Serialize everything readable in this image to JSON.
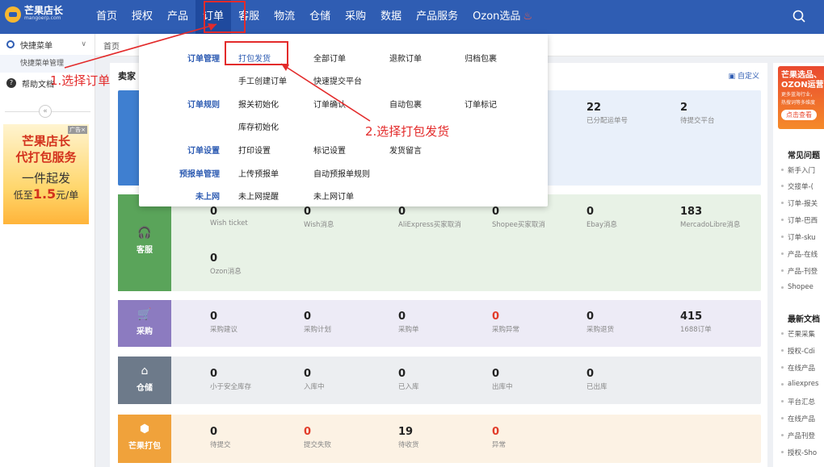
{
  "brand": {
    "name": "芒果店长",
    "domain": "mangoerp.com"
  },
  "nav": [
    "首页",
    "授权",
    "产品",
    "订单",
    "客服",
    "物流",
    "仓储",
    "采购",
    "数据",
    "产品服务",
    "Ozon选品"
  ],
  "sidebar": {
    "quick_menu": "快捷菜单",
    "quick_menu_manage": "快捷菜单管理",
    "help_docs": "帮助文档",
    "collapse": "«",
    "ad": {
      "tag": "广告×",
      "line1": "芒果店长",
      "line2": "代打包服务",
      "line3": "一件起发",
      "line4_pre": "低至",
      "line4_num": "1.5",
      "line4_post": "元/单"
    }
  },
  "breadcrumb": "首页",
  "main": {
    "title": "卖家",
    "customize": "自定义"
  },
  "dropdown": [
    {
      "label": "订单管理",
      "items": [
        "打包发货",
        "全部订单",
        "退款订单",
        "归档包裹",
        "手工创建订单",
        "快速提交平台"
      ]
    },
    {
      "label": "订单规则",
      "items": [
        "报关初始化",
        "订单确认",
        "自动包裹",
        "订单标记",
        "库存初始化"
      ]
    },
    {
      "label": "订单设置",
      "items": [
        "打印设置",
        "标记设置",
        "发货留言"
      ]
    },
    {
      "label": "预报单管理",
      "items": [
        "上传预报单",
        "自动预报单规则"
      ]
    },
    {
      "label": "未上网",
      "items": [
        "未上网提醒",
        "未上网订单"
      ]
    }
  ],
  "order_stats": [
    {
      "value": "22",
      "label": "已分配运单号"
    },
    {
      "value": "2",
      "label": "待提交平台"
    }
  ],
  "service": {
    "label": "客服",
    "stats": [
      {
        "value": "0",
        "label": "Wish ticket"
      },
      {
        "value": "0",
        "label": "Wish消息"
      },
      {
        "value": "0",
        "label": "AliExpress买家取消"
      },
      {
        "value": "0",
        "label": "Shopee买家取消"
      },
      {
        "value": "0",
        "label": "Ebay消息"
      },
      {
        "value": "183",
        "label": "MercadoLibre消息"
      },
      {
        "value": "0",
        "label": "Ozon消息"
      }
    ]
  },
  "purchase": {
    "label": "采购",
    "stats": [
      {
        "value": "0",
        "label": "采购建议"
      },
      {
        "value": "0",
        "label": "采购计划"
      },
      {
        "value": "0",
        "label": "采购单"
      },
      {
        "value": "0",
        "label": "采购异常"
      },
      {
        "value": "0",
        "label": "采购退货"
      },
      {
        "value": "415",
        "label": "1688订单"
      }
    ]
  },
  "warehouse": {
    "label": "仓储",
    "stats": [
      {
        "value": "0",
        "label": "小于安全库存"
      },
      {
        "value": "0",
        "label": "入库中"
      },
      {
        "value": "0",
        "label": "已入库"
      },
      {
        "value": "0",
        "label": "出库中"
      },
      {
        "value": "0",
        "label": "已出库"
      }
    ]
  },
  "packing": {
    "label": "芒果打包",
    "stats": [
      {
        "value": "0",
        "label": "待提交"
      },
      {
        "value": "0",
        "label": "提交失败"
      },
      {
        "value": "19",
        "label": "待收货"
      },
      {
        "value": "0",
        "label": "异常"
      }
    ]
  },
  "right": {
    "promo": {
      "line1": "芒果选品、",
      "line2": "OZON运营",
      "line3": "更多蓝海行业，",
      "line4": "热搜词等多维度",
      "button": "点击查看"
    },
    "faq_title": "常见问题",
    "faq": [
      "新手入门",
      "交接单-(",
      "订单-报关",
      "订单-巴西",
      "订单-sku",
      "产品-在线",
      "产品-刊登",
      "Shopee"
    ],
    "docs_title": "最新文档",
    "docs": [
      "芒果采集",
      "授权-Cdi",
      "在线产品",
      "aliexpres",
      "平台汇总",
      "在线产品",
      "产品刊登",
      "授权-Sho"
    ]
  },
  "annotations": {
    "step1": "1.选择订单",
    "step2": "2.选择打包发货"
  },
  "colors": {
    "primary": "#2f5db3",
    "highlight": "#e32b2b",
    "service": "#5aa45a",
    "purchase": "#8c7bc0",
    "warehouse": "#6d7a8a",
    "packing": "#f0a23b",
    "order": "#3f7fd0"
  }
}
